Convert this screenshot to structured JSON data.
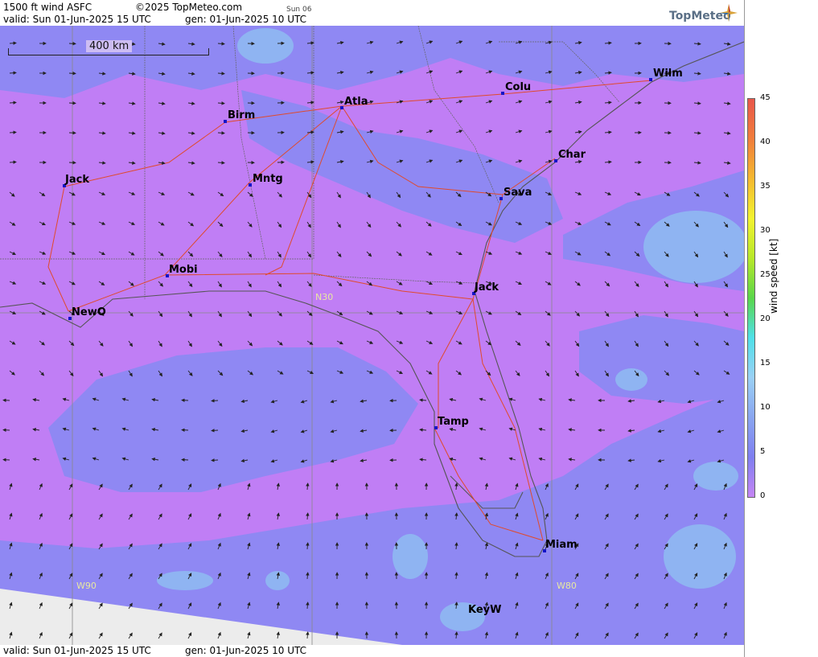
{
  "header": {
    "title": "1500 ft wind ASFC",
    "copyright": "©2025 TopMeteo.com",
    "day_tag": "Sun 06",
    "valid": "valid:  Sun  01-Jun-2025  15 UTC",
    "generated": "gen: 01-Jun-2025 10 UTC",
    "brand": "TopMeteo"
  },
  "footer": {
    "valid": "valid:  Sun  01-Jun-2025  15 UTC",
    "generated": "gen: 01-Jun-2025 10 UTC"
  },
  "map": {
    "scale_label": "400 km",
    "gridlines": [
      "N30",
      "W90",
      "W80"
    ],
    "cities": [
      "Wilm",
      "Colu",
      "Atla",
      "Birm",
      "Char",
      "Mntg",
      "Jack",
      "Sava",
      "Mobi",
      "Jack",
      "NewO",
      "Tamp",
      "Miam",
      "KeyW"
    ]
  },
  "colorbar": {
    "title": "wind speed [kt]",
    "ticks": [
      "45",
      "40",
      "35",
      "30",
      "25",
      "20",
      "15",
      "10",
      "5",
      "0"
    ],
    "colors": [
      "#e8574a",
      "#f07d3c",
      "#f5b830",
      "#f2f230",
      "#b8e82a",
      "#5ad64a",
      "#4fe0e8",
      "#9ad0f5",
      "#8aa6f0",
      "#7f7ff0",
      "#c485f5"
    ]
  }
}
